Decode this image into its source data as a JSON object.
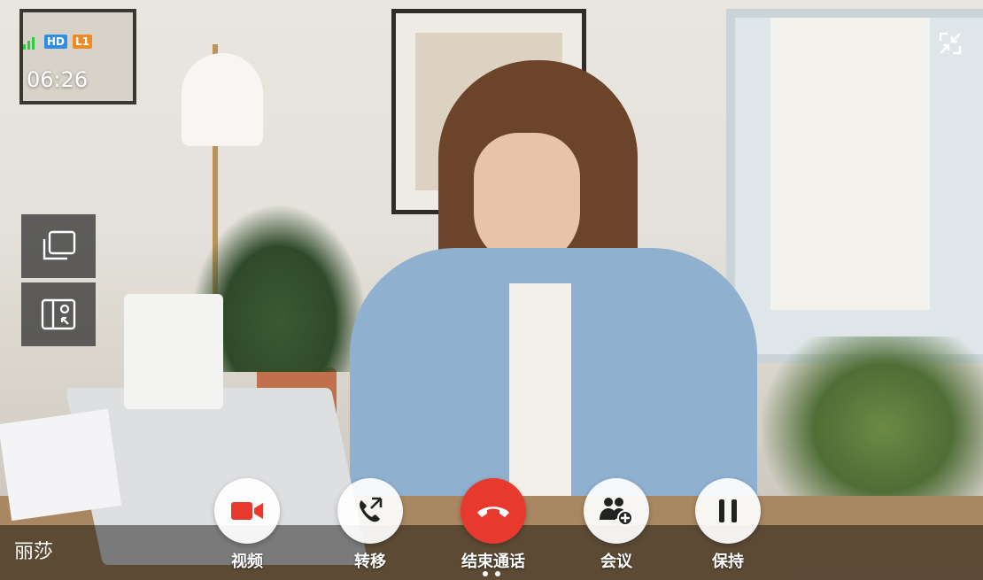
{
  "status": {
    "hd_badge": "HD",
    "line_badge": "L1",
    "timer": "06:26"
  },
  "caller": {
    "name": "丽莎"
  },
  "controls": [
    {
      "id": "video",
      "label": "视频",
      "icon": "video-camera-icon"
    },
    {
      "id": "transfer",
      "label": "转移",
      "icon": "call-transfer-icon"
    },
    {
      "id": "end",
      "label": "结束通话",
      "icon": "hang-up-icon"
    },
    {
      "id": "conference",
      "label": "会议",
      "icon": "add-participant-icon"
    },
    {
      "id": "hold",
      "label": "保持",
      "icon": "pause-icon"
    }
  ],
  "colors": {
    "end_call_red": "#e8392e",
    "video_icon_red": "#e8392e",
    "signal_green": "#2ecc40",
    "hd_blue": "#2f8de4",
    "line_orange": "#f08a24"
  },
  "page_indicator": {
    "count": 2,
    "active": 0
  }
}
